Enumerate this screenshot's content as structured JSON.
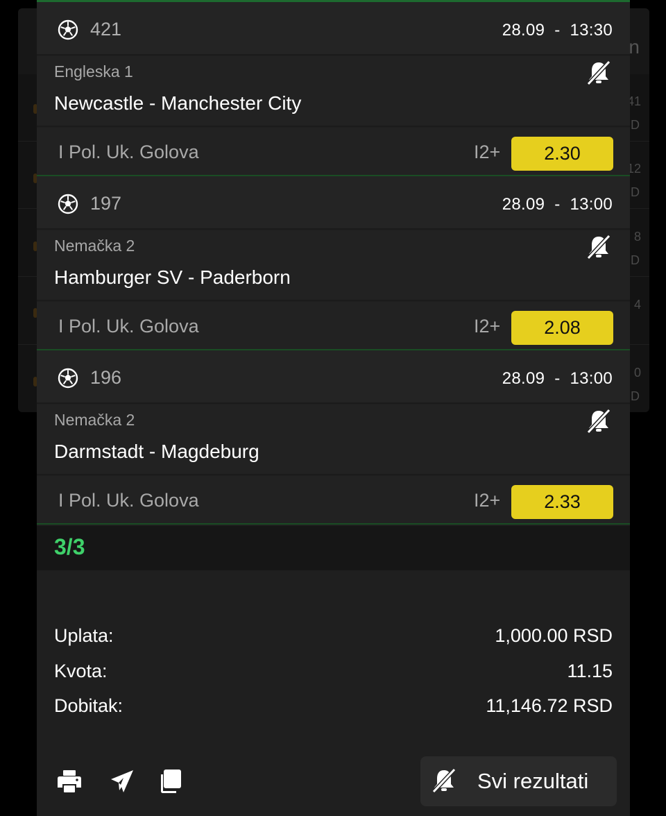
{
  "background_page": {
    "header_partial": "n",
    "right_column": [
      "41",
      "D",
      "12",
      "D",
      "8",
      "D",
      "4",
      "0",
      "D"
    ]
  },
  "matches": [
    {
      "code": "421",
      "datetime": "28.09  -  13:30",
      "league": "Engleska 1",
      "teams": "Newcastle - Manchester City",
      "market": "I Pol. Uk. Golova",
      "selection": "I2+",
      "odd": "2.30"
    },
    {
      "code": "197",
      "datetime": "28.09  -  13:00",
      "league": "Nemačka 2",
      "teams": "Hamburger SV - Paderborn",
      "market": "I Pol. Uk. Golova",
      "selection": "I2+",
      "odd": "2.08"
    },
    {
      "code": "196",
      "datetime": "28.09  -  13:00",
      "league": "Nemačka 2",
      "teams": "Darmstadt - Magdeburg",
      "market": "I Pol. Uk. Golova",
      "selection": "I2+",
      "odd": "2.33"
    }
  ],
  "status": {
    "count": "3/3",
    "color": "#3fd16a"
  },
  "summary": {
    "stake_label": "Uplata:",
    "stake_value": "1,000.00 RSD",
    "odds_label": "Kvota:",
    "odds_value": "11.15",
    "win_label": "Dobitak:",
    "win_value": "11,146.72 RSD"
  },
  "actions": {
    "print_icon": "printer-icon",
    "share_icon": "send-icon",
    "copy_icon": "copy-icon",
    "results_label": "Svi rezultati"
  },
  "colors": {
    "odd_button": "#e6cf1e",
    "accent_green": "#1d6a2f",
    "background": "#1f1f1f"
  }
}
